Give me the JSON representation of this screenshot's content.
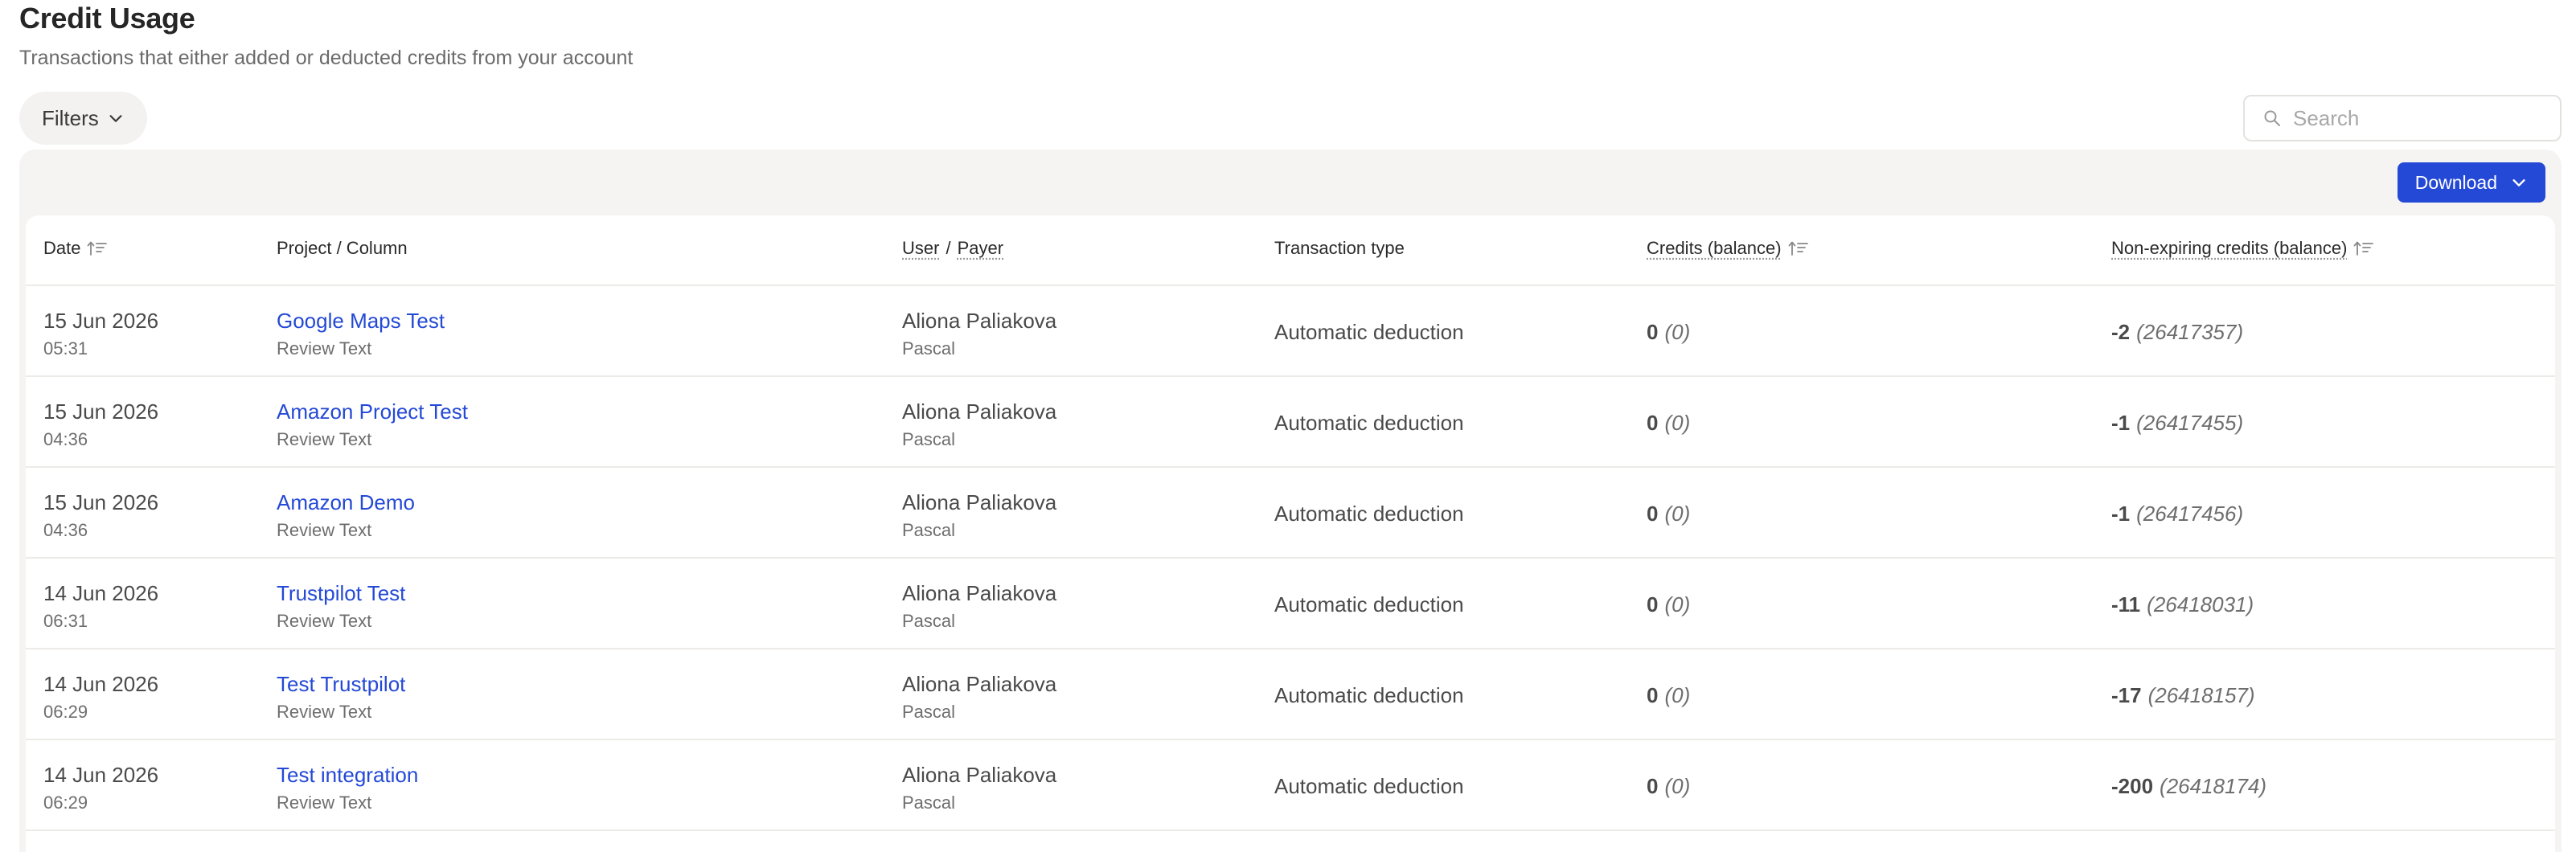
{
  "header": {
    "title": "Credit Usage",
    "subtitle": "Transactions that either added or deducted credits from your account"
  },
  "toolbar": {
    "filters_label": "Filters",
    "search_placeholder": "Search",
    "download_label": "Download"
  },
  "table": {
    "columns": {
      "date": "Date",
      "project": "Project / Column",
      "user": "User",
      "user_sep": "/",
      "payer": "Payer",
      "transaction_type": "Transaction type",
      "credits": "Credits (balance)",
      "nonexpiring": "Non-expiring credits (balance)"
    },
    "rows": [
      {
        "date": "15 Jun 2026",
        "time": "05:31",
        "project": "Google Maps Test",
        "column": "Review Text",
        "user": "Aliona Paliakova",
        "payer": "Pascal",
        "type": "Automatic deduction",
        "credits": "0",
        "credits_balance": "(0)",
        "nonexp": "-2",
        "nonexp_balance": "(26417357)"
      },
      {
        "date": "15 Jun 2026",
        "time": "04:36",
        "project": "Amazon Project Test",
        "column": "Review Text",
        "user": "Aliona Paliakova",
        "payer": "Pascal",
        "type": "Automatic deduction",
        "credits": "0",
        "credits_balance": "(0)",
        "nonexp": "-1",
        "nonexp_balance": "(26417455)"
      },
      {
        "date": "15 Jun 2026",
        "time": "04:36",
        "project": "Amazon Demo",
        "column": "Review Text",
        "user": "Aliona Paliakova",
        "payer": "Pascal",
        "type": "Automatic deduction",
        "credits": "0",
        "credits_balance": "(0)",
        "nonexp": "-1",
        "nonexp_balance": "(26417456)"
      },
      {
        "date": "14 Jun 2026",
        "time": "06:31",
        "project": "Trustpilot Test",
        "column": "Review Text",
        "user": "Aliona Paliakova",
        "payer": "Pascal",
        "type": "Automatic deduction",
        "credits": "0",
        "credits_balance": "(0)",
        "nonexp": "-11",
        "nonexp_balance": "(26418031)"
      },
      {
        "date": "14 Jun 2026",
        "time": "06:29",
        "project": "Test Trustpilot",
        "column": "Review Text",
        "user": "Aliona Paliakova",
        "payer": "Pascal",
        "type": "Automatic deduction",
        "credits": "0",
        "credits_balance": "(0)",
        "nonexp": "-17",
        "nonexp_balance": "(26418157)"
      },
      {
        "date": "14 Jun 2026",
        "time": "06:29",
        "project": "Test integration",
        "column": "Review Text",
        "user": "Aliona Paliakova",
        "payer": "Pascal",
        "type": "Automatic deduction",
        "credits": "0",
        "credits_balance": "(0)",
        "nonexp": "-200",
        "nonexp_balance": "(26418174)"
      }
    ]
  },
  "icons": {
    "filters": "chevron-down-icon",
    "search": "search-icon",
    "download": "chevron-down-icon",
    "sort": "sort-icon"
  },
  "colors": {
    "accent": "#2449d6",
    "link": "#2449d6",
    "panel_bg": "#f5f4f2"
  }
}
